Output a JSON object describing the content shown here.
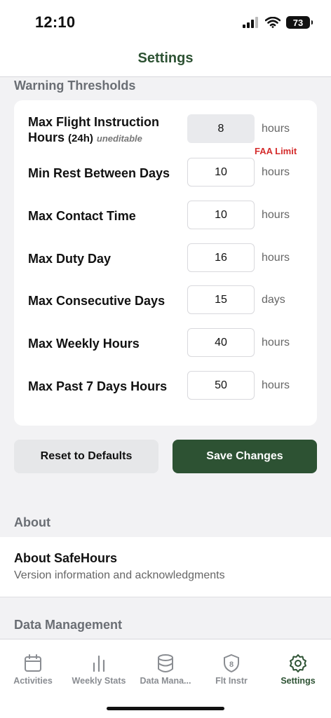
{
  "status": {
    "time": "12:10",
    "battery": "73"
  },
  "header": {
    "title": "Settings"
  },
  "warning": {
    "section_title": "Warning Thresholds",
    "rows": [
      {
        "label_line1": "Max Flight Instruction",
        "label_line2": "Hours",
        "label_small": "(24h)",
        "label_note": "uneditable",
        "value": "8",
        "unit": "hours",
        "badge": "FAA Limit"
      },
      {
        "label": "Min Rest Between Days",
        "value": "10",
        "unit": "hours"
      },
      {
        "label": "Max Contact Time",
        "value": "10",
        "unit": "hours"
      },
      {
        "label": "Max Duty Day",
        "value": "16",
        "unit": "hours"
      },
      {
        "label": "Max Consecutive Days",
        "value": "15",
        "unit": "days"
      },
      {
        "label": "Max Weekly Hours",
        "value": "40",
        "unit": "hours"
      },
      {
        "label": "Max Past 7 Days Hours",
        "value": "50",
        "unit": "hours"
      }
    ]
  },
  "buttons": {
    "reset": "Reset to Defaults",
    "save": "Save Changes"
  },
  "about": {
    "section_title": "About",
    "item_title": "About SafeHours",
    "item_subtitle": "Version information and acknowledgments"
  },
  "data_management": {
    "section_title": "Data Management"
  },
  "tabs": [
    {
      "label": "Activities",
      "icon": "calendar-icon"
    },
    {
      "label": "Weekly Stats",
      "icon": "bar-chart-icon"
    },
    {
      "label": "Data Mana...",
      "icon": "database-icon"
    },
    {
      "label": "Flt Instr",
      "icon": "shield-icon",
      "badge": "8"
    },
    {
      "label": "Settings",
      "icon": "gear-icon"
    }
  ],
  "colors": {
    "accent": "#2d5233",
    "warning": "#d42c2c",
    "section": "#6a6e74"
  }
}
